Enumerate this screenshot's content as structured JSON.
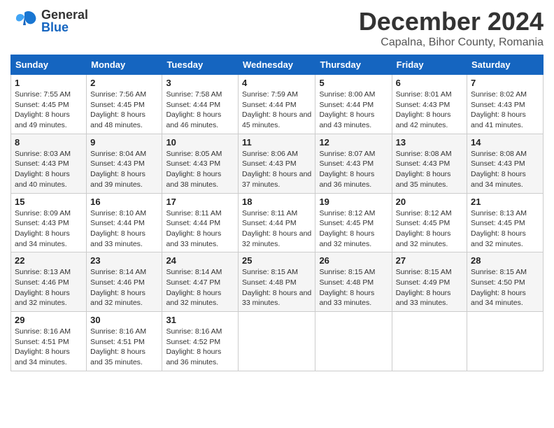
{
  "logo": {
    "general": "General",
    "blue": "Blue"
  },
  "title": "December 2024",
  "subtitle": "Capalna, Bihor County, Romania",
  "weekdays": [
    "Sunday",
    "Monday",
    "Tuesday",
    "Wednesday",
    "Thursday",
    "Friday",
    "Saturday"
  ],
  "weeks": [
    [
      {
        "day": "1",
        "sunrise": "Sunrise: 7:55 AM",
        "sunset": "Sunset: 4:45 PM",
        "daylight": "Daylight: 8 hours and 49 minutes."
      },
      {
        "day": "2",
        "sunrise": "Sunrise: 7:56 AM",
        "sunset": "Sunset: 4:45 PM",
        "daylight": "Daylight: 8 hours and 48 minutes."
      },
      {
        "day": "3",
        "sunrise": "Sunrise: 7:58 AM",
        "sunset": "Sunset: 4:44 PM",
        "daylight": "Daylight: 8 hours and 46 minutes."
      },
      {
        "day": "4",
        "sunrise": "Sunrise: 7:59 AM",
        "sunset": "Sunset: 4:44 PM",
        "daylight": "Daylight: 8 hours and 45 minutes."
      },
      {
        "day": "5",
        "sunrise": "Sunrise: 8:00 AM",
        "sunset": "Sunset: 4:44 PM",
        "daylight": "Daylight: 8 hours and 43 minutes."
      },
      {
        "day": "6",
        "sunrise": "Sunrise: 8:01 AM",
        "sunset": "Sunset: 4:43 PM",
        "daylight": "Daylight: 8 hours and 42 minutes."
      },
      {
        "day": "7",
        "sunrise": "Sunrise: 8:02 AM",
        "sunset": "Sunset: 4:43 PM",
        "daylight": "Daylight: 8 hours and 41 minutes."
      }
    ],
    [
      {
        "day": "8",
        "sunrise": "Sunrise: 8:03 AM",
        "sunset": "Sunset: 4:43 PM",
        "daylight": "Daylight: 8 hours and 40 minutes."
      },
      {
        "day": "9",
        "sunrise": "Sunrise: 8:04 AM",
        "sunset": "Sunset: 4:43 PM",
        "daylight": "Daylight: 8 hours and 39 minutes."
      },
      {
        "day": "10",
        "sunrise": "Sunrise: 8:05 AM",
        "sunset": "Sunset: 4:43 PM",
        "daylight": "Daylight: 8 hours and 38 minutes."
      },
      {
        "day": "11",
        "sunrise": "Sunrise: 8:06 AM",
        "sunset": "Sunset: 4:43 PM",
        "daylight": "Daylight: 8 hours and 37 minutes."
      },
      {
        "day": "12",
        "sunrise": "Sunrise: 8:07 AM",
        "sunset": "Sunset: 4:43 PM",
        "daylight": "Daylight: 8 hours and 36 minutes."
      },
      {
        "day": "13",
        "sunrise": "Sunrise: 8:08 AM",
        "sunset": "Sunset: 4:43 PM",
        "daylight": "Daylight: 8 hours and 35 minutes."
      },
      {
        "day": "14",
        "sunrise": "Sunrise: 8:08 AM",
        "sunset": "Sunset: 4:43 PM",
        "daylight": "Daylight: 8 hours and 34 minutes."
      }
    ],
    [
      {
        "day": "15",
        "sunrise": "Sunrise: 8:09 AM",
        "sunset": "Sunset: 4:43 PM",
        "daylight": "Daylight: 8 hours and 34 minutes."
      },
      {
        "day": "16",
        "sunrise": "Sunrise: 8:10 AM",
        "sunset": "Sunset: 4:44 PM",
        "daylight": "Daylight: 8 hours and 33 minutes."
      },
      {
        "day": "17",
        "sunrise": "Sunrise: 8:11 AM",
        "sunset": "Sunset: 4:44 PM",
        "daylight": "Daylight: 8 hours and 33 minutes."
      },
      {
        "day": "18",
        "sunrise": "Sunrise: 8:11 AM",
        "sunset": "Sunset: 4:44 PM",
        "daylight": "Daylight: 8 hours and 32 minutes."
      },
      {
        "day": "19",
        "sunrise": "Sunrise: 8:12 AM",
        "sunset": "Sunset: 4:45 PM",
        "daylight": "Daylight: 8 hours and 32 minutes."
      },
      {
        "day": "20",
        "sunrise": "Sunrise: 8:12 AM",
        "sunset": "Sunset: 4:45 PM",
        "daylight": "Daylight: 8 hours and 32 minutes."
      },
      {
        "day": "21",
        "sunrise": "Sunrise: 8:13 AM",
        "sunset": "Sunset: 4:45 PM",
        "daylight": "Daylight: 8 hours and 32 minutes."
      }
    ],
    [
      {
        "day": "22",
        "sunrise": "Sunrise: 8:13 AM",
        "sunset": "Sunset: 4:46 PM",
        "daylight": "Daylight: 8 hours and 32 minutes."
      },
      {
        "day": "23",
        "sunrise": "Sunrise: 8:14 AM",
        "sunset": "Sunset: 4:46 PM",
        "daylight": "Daylight: 8 hours and 32 minutes."
      },
      {
        "day": "24",
        "sunrise": "Sunrise: 8:14 AM",
        "sunset": "Sunset: 4:47 PM",
        "daylight": "Daylight: 8 hours and 32 minutes."
      },
      {
        "day": "25",
        "sunrise": "Sunrise: 8:15 AM",
        "sunset": "Sunset: 4:48 PM",
        "daylight": "Daylight: 8 hours and 33 minutes."
      },
      {
        "day": "26",
        "sunrise": "Sunrise: 8:15 AM",
        "sunset": "Sunset: 4:48 PM",
        "daylight": "Daylight: 8 hours and 33 minutes."
      },
      {
        "day": "27",
        "sunrise": "Sunrise: 8:15 AM",
        "sunset": "Sunset: 4:49 PM",
        "daylight": "Daylight: 8 hours and 33 minutes."
      },
      {
        "day": "28",
        "sunrise": "Sunrise: 8:15 AM",
        "sunset": "Sunset: 4:50 PM",
        "daylight": "Daylight: 8 hours and 34 minutes."
      }
    ],
    [
      {
        "day": "29",
        "sunrise": "Sunrise: 8:16 AM",
        "sunset": "Sunset: 4:51 PM",
        "daylight": "Daylight: 8 hours and 34 minutes."
      },
      {
        "day": "30",
        "sunrise": "Sunrise: 8:16 AM",
        "sunset": "Sunset: 4:51 PM",
        "daylight": "Daylight: 8 hours and 35 minutes."
      },
      {
        "day": "31",
        "sunrise": "Sunrise: 8:16 AM",
        "sunset": "Sunset: 4:52 PM",
        "daylight": "Daylight: 8 hours and 36 minutes."
      },
      null,
      null,
      null,
      null
    ]
  ]
}
